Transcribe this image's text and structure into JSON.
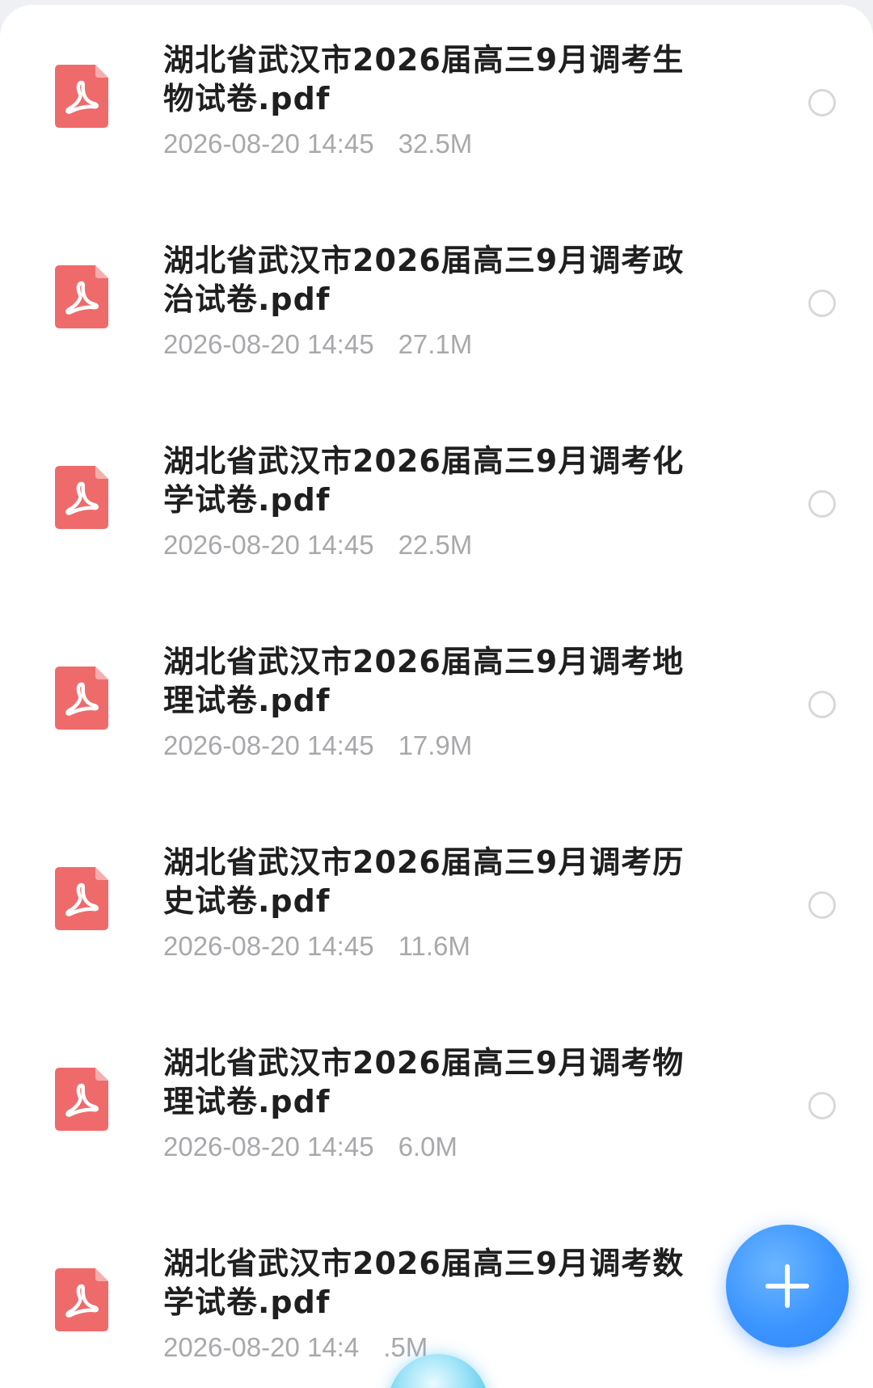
{
  "colors": {
    "pdf_icon": "#ef6b6b",
    "radio_border": "#d7d8db",
    "fab": "#3c95ff",
    "name_text": "#1f1f1f",
    "meta_text": "#a8a9ac"
  },
  "icons": {
    "file": "pdf-icon",
    "fab": "plus-icon",
    "select": "radio-unchecked"
  },
  "files": [
    {
      "name": "湖北省武汉市2026届高三9月调考生物试卷.pdf",
      "date": "2026-08-20 14:45",
      "size": "32.5M",
      "selected": false
    },
    {
      "name": "湖北省武汉市2026届高三9月调考政治试卷.pdf",
      "date": "2026-08-20 14:45",
      "size": "27.1M",
      "selected": false
    },
    {
      "name": "湖北省武汉市2026届高三9月调考化学试卷.pdf",
      "date": "2026-08-20 14:45",
      "size": "22.5M",
      "selected": false
    },
    {
      "name": "湖北省武汉市2026届高三9月调考地理试卷.pdf",
      "date": "2026-08-20 14:45",
      "size": "17.9M",
      "selected": false
    },
    {
      "name": "湖北省武汉市2026届高三9月调考历史试卷.pdf",
      "date": "2026-08-20 14:45",
      "size": "11.6M",
      "selected": false
    },
    {
      "name": "湖北省武汉市2026届高三9月调考物理试卷.pdf",
      "date": "2026-08-20 14:45",
      "size": "6.0M",
      "selected": false
    },
    {
      "name": "湖北省武汉市2026届高三9月调考数学试卷.pdf",
      "date": "2026-08-20 14:4",
      "size": ".5M",
      "selected": false
    }
  ]
}
